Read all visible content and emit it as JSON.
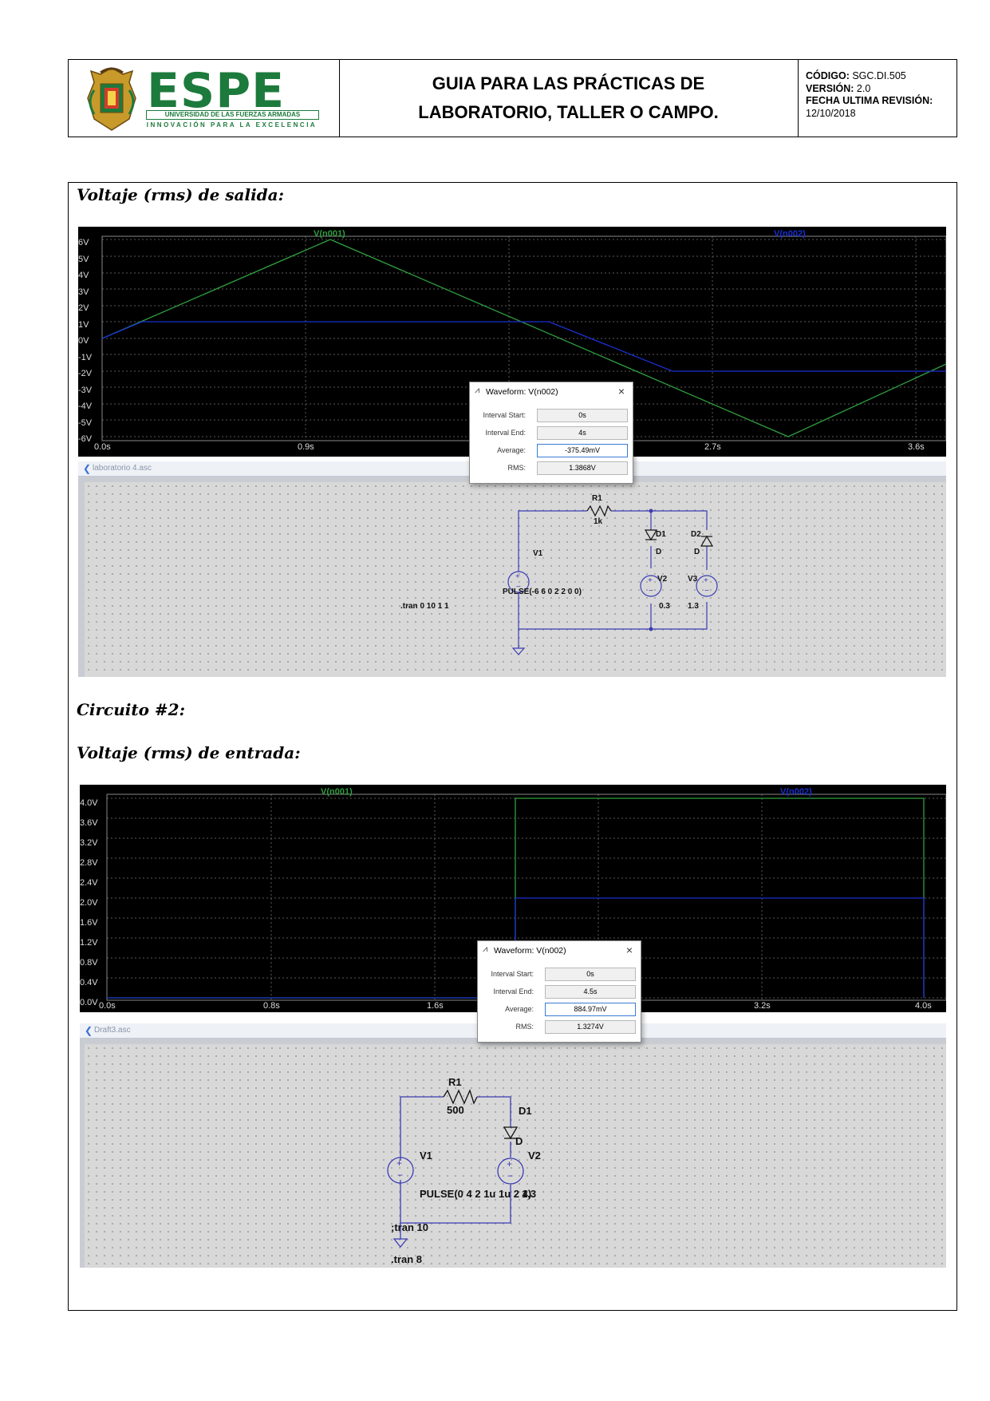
{
  "header": {
    "university_name": "UNIVERSIDAD DE LAS FUERZAS ARMADAS",
    "logo_text": "ESPE",
    "motto": "INNOVACIÓN PARA LA EXCELENCIA",
    "title_line1": "GUIA PARA LAS PRÁCTICAS DE",
    "title_line2": "LABORATORIO, TALLER O CAMPO.",
    "code_label": "CÓDIGO:",
    "code_value": "SGC.DI.505",
    "version_label": "VERSIÓN:",
    "version_value": "2.0",
    "revision_label": "FECHA ULTIMA REVISIÓN:",
    "revision_value": "12/10/2018"
  },
  "section1": {
    "heading": "Voltaje (rms) de salida:",
    "plot": {
      "trace1_label": "V(n001)",
      "trace2_label": "V(n002)",
      "y_ticks": [
        "6V",
        "5V",
        "4V",
        "3V",
        "2V",
        "1V",
        "0V",
        "-1V",
        "-2V",
        "-3V",
        "-4V",
        "-5V",
        "-6V"
      ],
      "x_ticks": [
        "0.0s",
        "0.9s",
        "2.7s",
        "3.6s"
      ]
    },
    "dialog": {
      "title": "Waveform: V(n002)",
      "close": "×",
      "rows": [
        {
          "label": "Interval Start:",
          "value": "0s"
        },
        {
          "label": "Interval End:",
          "value": "4s"
        },
        {
          "label": "Average:",
          "value": "-375.49mV"
        },
        {
          "label": "RMS:",
          "value": "1.3868V"
        }
      ]
    },
    "schematic": {
      "tab": "laboratorio 4.asc",
      "r1": "R1",
      "r1_val": "1k",
      "d1": "D1",
      "d1_model": "D",
      "d2": "D2",
      "d2_model": "D",
      "v1": "V1",
      "v1_val": "PULSE(-6 6 0 2 2 0 0)",
      "v2": "V2",
      "v2_val": "0.3",
      "v3": "V3",
      "v3_val": "1.3",
      "tran": ".tran 0 10 1 1"
    }
  },
  "section2": {
    "heading1": "Circuito #2:",
    "heading2": "Voltaje (rms) de entrada:",
    "plot": {
      "trace1_label": "V(n001)",
      "trace2_label": "V(n002)",
      "y_ticks": [
        "4.0V",
        "3.6V",
        "3.2V",
        "2.8V",
        "2.4V",
        "2.0V",
        "1.6V",
        "1.2V",
        "0.8V",
        "0.4V",
        "0.0V"
      ],
      "x_ticks": [
        "0.0s",
        "0.8s",
        "1.6s",
        "3.2s",
        "4.0s"
      ]
    },
    "dialog": {
      "title": "Waveform: V(n002)",
      "close": "×",
      "rows": [
        {
          "label": "Interval Start:",
          "value": "0s"
        },
        {
          "label": "Interval End:",
          "value": "4.5s"
        },
        {
          "label": "Average:",
          "value": "884.97mV"
        },
        {
          "label": "RMS:",
          "value": "1.3274V"
        }
      ]
    },
    "schematic": {
      "tab": "Draft3.asc",
      "r1": "R1",
      "r1_val": "500",
      "d1": "D1",
      "d1_model": "D",
      "v1": "V1",
      "v1_val": "PULSE(0 4 2 1u 1u 2 4)",
      "v2": "V2",
      "v2_val": "1.3",
      "tran_comment": ";tran 10",
      "tran": ".tran 8"
    }
  },
  "colors": {
    "brand_green": "#1c7a3c",
    "trace_green": "#2e9e3e",
    "trace_blue": "#1a2fd0",
    "wire_blue": "#3c3cb4"
  }
}
